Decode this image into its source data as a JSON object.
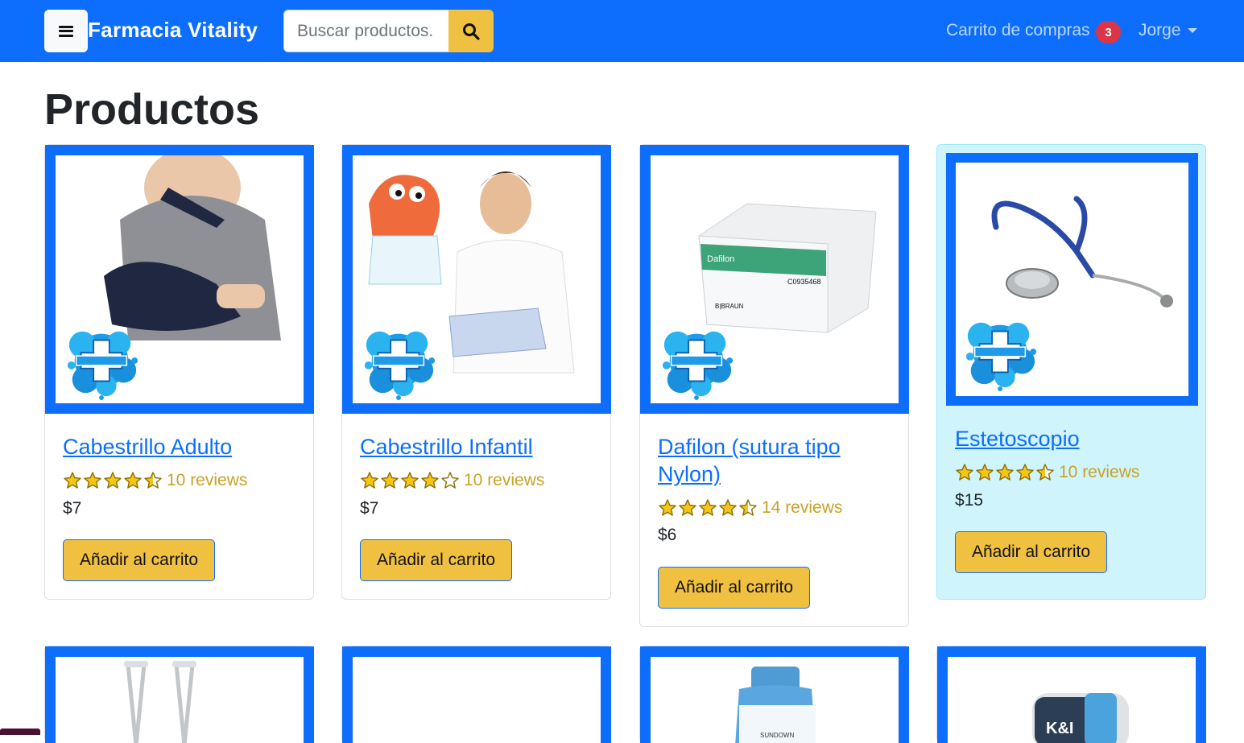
{
  "navbar": {
    "brand": "Farmacia Vitality",
    "search_placeholder": "Buscar productos.",
    "cart_label": "Carrito de compras",
    "cart_count": "3",
    "user_name": "Jorge"
  },
  "page": {
    "title": "Productos"
  },
  "logo_text": "VITALITY",
  "products": [
    {
      "name": "Cabestrillo Adulto",
      "rating": 4.5,
      "reviews": "10 reviews",
      "price": "$7",
      "button": "Añadir al carrito"
    },
    {
      "name": "Cabestrillo Infantil",
      "rating": 4,
      "reviews": "10 reviews",
      "price": "$7",
      "button": "Añadir al carrito"
    },
    {
      "name": "Dafilon (sutura tipo Nylon)",
      "rating": 4.5,
      "reviews": "14 reviews",
      "price": "$6",
      "button": "Añadir al carrito"
    },
    {
      "name": "Estetoscopio",
      "rating": 4.5,
      "reviews": "10 reviews",
      "price": "$15",
      "button": "Añadir al carrito"
    }
  ],
  "product_images_text": {
    "dafilon_box": "Dafilon",
    "dafilon_code": "C0935468",
    "dafilon_maker": "B|BRAUN",
    "vitamin_label": "SUNDOWN",
    "device_label": "K&I"
  },
  "colors": {
    "primary": "#0d6efd",
    "accent": "#f0c141",
    "badge": "#dc3545",
    "star": "#f5c518"
  }
}
